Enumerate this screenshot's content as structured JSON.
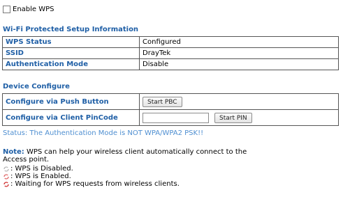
{
  "enable_wps": {
    "label": "Enable WPS",
    "checked": false
  },
  "wps_info": {
    "title": "Wi-Fi Protected Setup Information",
    "rows": [
      {
        "label": "WPS Status",
        "value": "Configured"
      },
      {
        "label": "SSID",
        "value": "DrayTek"
      },
      {
        "label": "Authentication Mode",
        "value": "Disable"
      }
    ]
  },
  "device_configure": {
    "title": "Device Configure",
    "push_button": {
      "label": "Configure via Push Button",
      "button": "Start PBC"
    },
    "pin_code": {
      "label": "Configure via Client PinCode",
      "input_value": "",
      "button": "Start PIN"
    }
  },
  "status_text": "Status: The Authentication Mode is NOT WPA/WPA2 PSK!!",
  "note": {
    "label": "Note:",
    "text": " WPS can help your wireless client automatically connect to the Access point.",
    "legend": [
      {
        "icon": "wps-disabled-icon",
        "color": "#b8b8b8",
        "text": ": WPS is Disabled."
      },
      {
        "icon": "wps-enabled-icon",
        "color": "#e06a6a",
        "text": ": WPS is Enabled."
      },
      {
        "icon": "wps-waiting-icon",
        "color": "#d03030",
        "text": ": Waiting for WPS requests from wireless clients."
      }
    ]
  }
}
